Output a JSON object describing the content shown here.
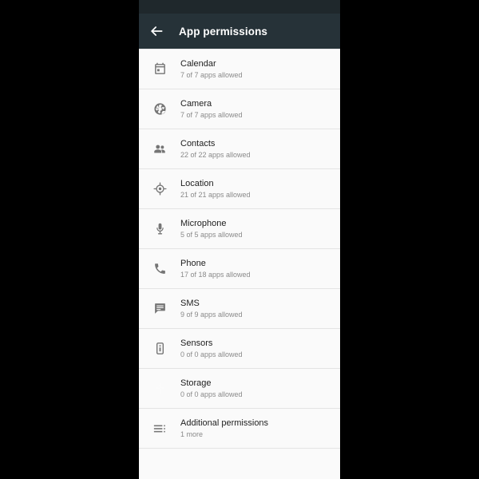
{
  "app_bar": {
    "title": "App permissions",
    "back_icon": "arrow-back-icon",
    "background_color": "#263238",
    "title_color": "#ffffff"
  },
  "status_bar": {
    "background_color": "#1f282c"
  },
  "theme": {
    "page_background": "#000000",
    "list_background": "#fafafa",
    "divider_color": "#e4e4e4",
    "title_text_color": "#212121",
    "subtitle_text_color": "#8a8a8a",
    "icon_color": "#757575",
    "storage_icon_color": "#fbfbfb"
  },
  "permissions": [
    {
      "id": "calendar",
      "icon": "calendar-icon",
      "label": "Calendar",
      "summary": "7 of 7 apps allowed"
    },
    {
      "id": "camera",
      "icon": "camera-aperture-icon",
      "label": "Camera",
      "summary": "7 of 7 apps allowed"
    },
    {
      "id": "contacts",
      "icon": "contacts-people-icon",
      "label": "Contacts",
      "summary": "22 of 22 apps allowed"
    },
    {
      "id": "location",
      "icon": "location-crosshair-icon",
      "label": "Location",
      "summary": "21 of 21 apps allowed"
    },
    {
      "id": "microphone",
      "icon": "microphone-icon",
      "label": "Microphone",
      "summary": "5 of 5 apps allowed"
    },
    {
      "id": "phone",
      "icon": "phone-handset-icon",
      "label": "Phone",
      "summary": "17 of 18 apps allowed"
    },
    {
      "id": "sms",
      "icon": "sms-message-icon",
      "label": "SMS",
      "summary": "9 of 9 apps allowed"
    },
    {
      "id": "sensors",
      "icon": "body-sensors-icon",
      "label": "Sensors",
      "summary": "0 of 0 apps allowed"
    },
    {
      "id": "storage",
      "icon": "storage-usb-icon",
      "label": "Storage",
      "summary": "0 of 0 apps allowed"
    },
    {
      "id": "additional",
      "icon": "additional-list-icon",
      "label": "Additional permissions",
      "summary": "1 more"
    }
  ]
}
